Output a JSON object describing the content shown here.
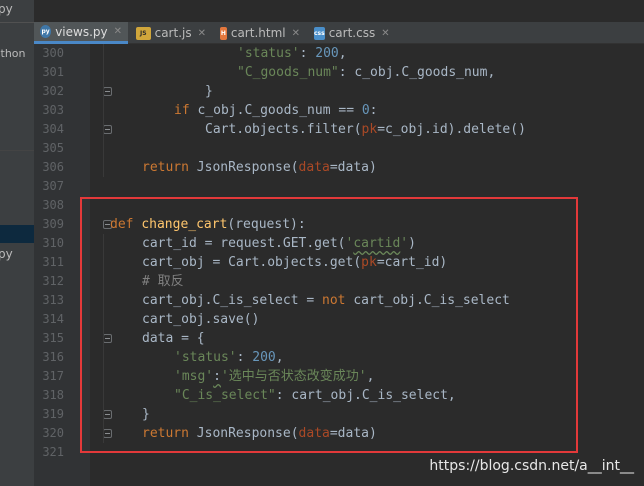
{
  "left_panel": {
    "fragment_top": "py",
    "fragment_mid": "ython",
    "fragment_sel": "py"
  },
  "tabs": [
    {
      "label": "views.py",
      "icon": "python-file-icon",
      "active": true
    },
    {
      "label": "cart.js",
      "icon": "js-file-icon",
      "active": false
    },
    {
      "label": "cart.html",
      "icon": "html-file-icon",
      "active": false
    },
    {
      "label": "cart.css",
      "icon": "css-file-icon",
      "active": false
    }
  ],
  "line_numbers": [
    "300",
    "301",
    "302",
    "303",
    "304",
    "305",
    "306",
    "307",
    "308",
    "309",
    "310",
    "311",
    "312",
    "313",
    "314",
    "315",
    "316",
    "317",
    "318",
    "319",
    "320",
    "321"
  ],
  "code": {
    "l300": {
      "str": "'status'",
      "p1": ": ",
      "num": "200",
      "p2": ","
    },
    "l301": {
      "str": "\"C_goods_num\"",
      "p1": ": c_obj.C_goods_num,"
    },
    "l302": {
      "p1": "}"
    },
    "l303": {
      "kw": "if",
      "p1": " c_obj.C_goods_num == ",
      "num": "0",
      "p2": ":"
    },
    "l304": {
      "p1": "Cart.objects.filter(",
      "param": "pk",
      "p2": "=c_obj.id).delete()"
    },
    "l306": {
      "kw": "return",
      "p1": " JsonResponse(",
      "param": "data",
      "p2": "=data)"
    },
    "l309": {
      "kw": "def",
      "fn": "change_cart",
      "p1": "(request):"
    },
    "l310": {
      "p1": "cart_id = request.GET.get(",
      "str_a": "'",
      "str_b": "cartid",
      "str_c": "'",
      "p2": ")"
    },
    "l311": {
      "p1": "cart_obj = Cart.objects.get(",
      "param": "pk",
      "p2": "=cart_id)"
    },
    "l312": {
      "cm": "# 取反"
    },
    "l313": {
      "p1": "cart_obj.C_is_select = ",
      "kw": "not",
      "p2": " cart_obj.C_is_select"
    },
    "l314": {
      "p1": "cart_obj.save()"
    },
    "l315": {
      "p1": "data = {"
    },
    "l316": {
      "str": "'status'",
      "p1": ": ",
      "num": "200",
      "p2": ","
    },
    "l317": {
      "str_a": "'msg'",
      "p1": ":",
      "str_b": "'选中与否状态改变成功'",
      "p2": ","
    },
    "l318": {
      "str": "\"C_is_select\"",
      "p1": ": cart_obj.C_is_select,"
    },
    "l319": {
      "p1": "}"
    },
    "l320": {
      "kw": "return",
      "p1": " JsonResponse(",
      "param": "data",
      "p2": "=data)"
    }
  },
  "watermark": "https://blog.csdn.net/a__int__",
  "colors": {
    "editor_bg": "#2b2b2b",
    "gutter_bg": "#313335",
    "keyword": "#cc7832",
    "function": "#ffc66d",
    "string": "#6a8759",
    "number": "#6897bb",
    "param": "#aa4926",
    "comment": "#808080",
    "highlight_box": "#e3393a"
  }
}
